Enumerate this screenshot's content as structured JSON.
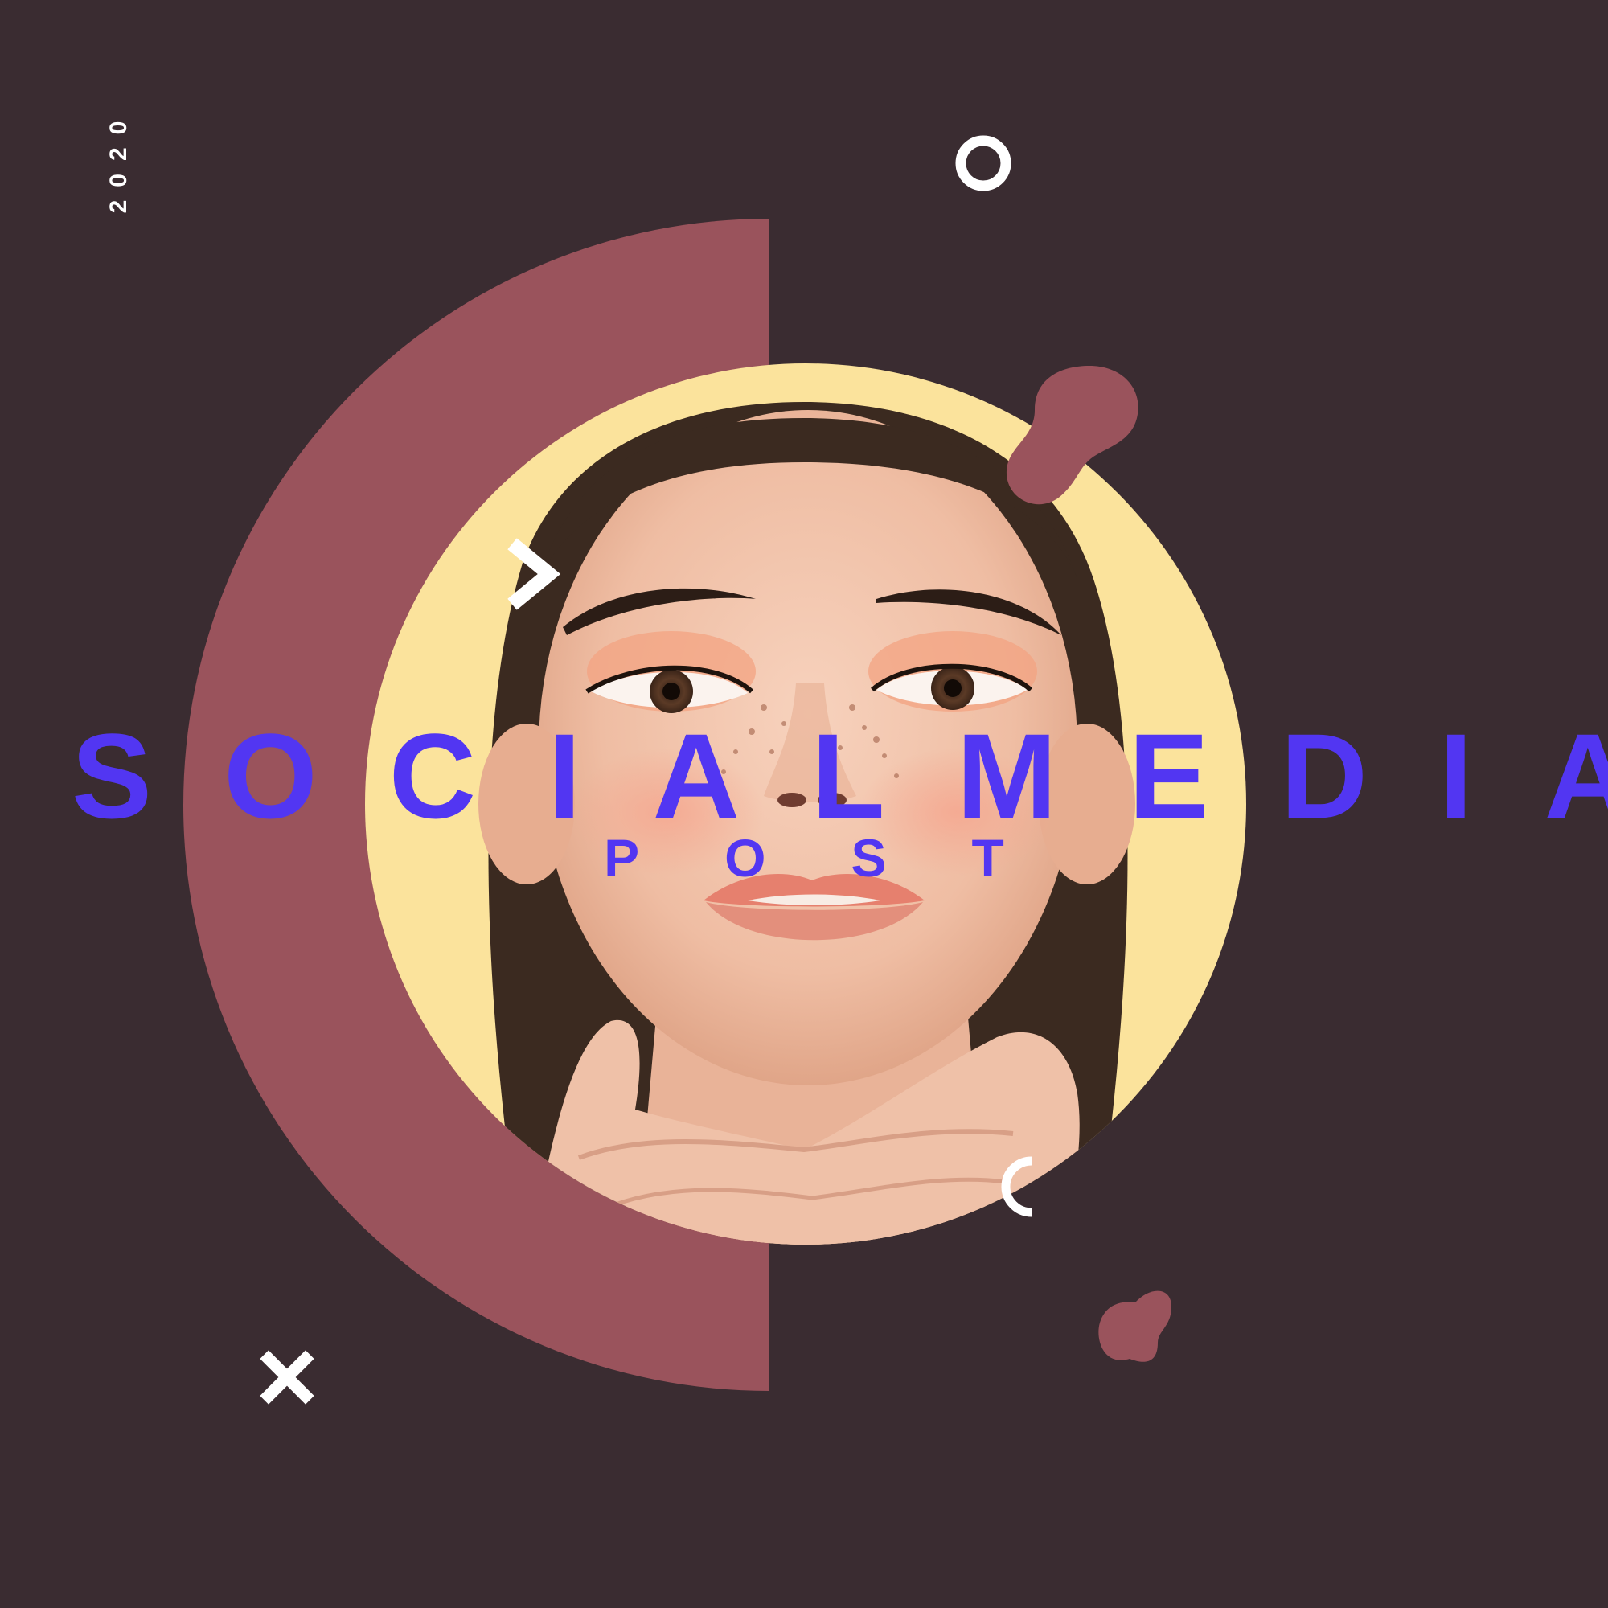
{
  "poster": {
    "year": "2020",
    "title": "SOCIALMEDIA",
    "subtitle": "POST"
  },
  "colors": {
    "background": "#3a2c31",
    "accent_shape": "#9a535c",
    "title_text": "#5236f2",
    "photo_backdrop": "#fbe39c",
    "decor_white": "#ffffff"
  },
  "icons": [
    "ring-icon",
    "chevron-right-icon",
    "open-ring-icon",
    "x-cross-icon",
    "blob-shape"
  ]
}
